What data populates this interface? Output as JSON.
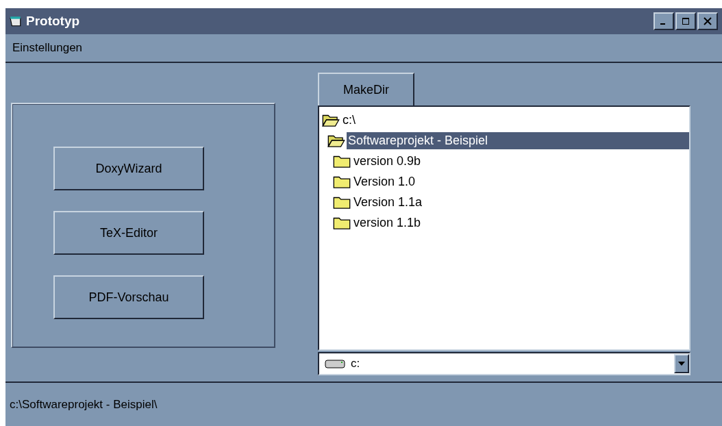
{
  "window": {
    "title": "Prototyp"
  },
  "menu": [
    "Einstellungen"
  ],
  "buttons": [
    "DoxyWizard",
    "TeX-Editor",
    "PDF-Vorschau"
  ],
  "make_dir_button": "MakeDir",
  "directory_tree": [
    {
      "label": "c:\\",
      "expanded": true,
      "selected": false,
      "children": [
        {
          "label": "Softwareprojekt - Beispiel",
          "expanded": true,
          "selected": true,
          "children": [
            {
              "label": "version 0.9b",
              "expanded": false,
              "selected": false
            },
            {
              "label": "Version 1.0",
              "expanded": false,
              "selected": false
            },
            {
              "label": "Version 1.1a",
              "expanded": false,
              "selected": false
            },
            {
              "label": "version 1.1b",
              "expanded": false,
              "selected": false
            }
          ]
        }
      ]
    }
  ],
  "drive": {
    "value": "c:"
  },
  "status_bar": "c:\\Softwareprojekt - Beispiel\\"
}
